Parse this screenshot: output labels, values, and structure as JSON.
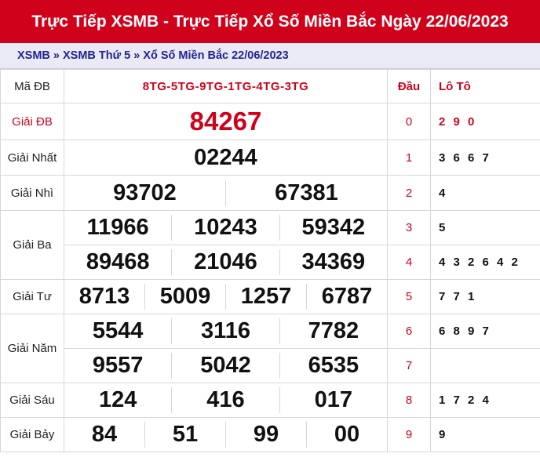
{
  "title": "Trực Tiếp XSMB - Trực Tiếp Xổ Số Miền Bắc Ngày 22/06/2023",
  "breadcrumb": [
    "XSMB",
    "XSMB Thứ 5",
    "Xổ Số Miền Bắc 22/06/2023"
  ],
  "breadcrumb_sep": "»",
  "header": {
    "ma_db_label": "Mã ĐB",
    "ma_db_value": "8TG-5TG-9TG-1TG-4TG-3TG",
    "dau_label": "Đầu",
    "loto_label": "Lô Tô"
  },
  "prizes": {
    "db": {
      "label": "Giải ĐB",
      "numbers": [
        "84267"
      ]
    },
    "nhat": {
      "label": "Giải Nhất",
      "numbers": [
        "02244"
      ]
    },
    "nhi": {
      "label": "Giải Nhì",
      "numbers": [
        "93702",
        "67381"
      ]
    },
    "ba": {
      "label": "Giải Ba",
      "numbers": [
        "11966",
        "10243",
        "59342",
        "89468",
        "21046",
        "34369"
      ]
    },
    "tu": {
      "label": "Giải Tư",
      "numbers": [
        "8713",
        "5009",
        "1257",
        "6787"
      ]
    },
    "nam": {
      "label": "Giải Năm",
      "numbers": [
        "5544",
        "3116",
        "7782",
        "9557",
        "5042",
        "6535"
      ]
    },
    "sau": {
      "label": "Giải Sáu",
      "numbers": [
        "124",
        "416",
        "017"
      ]
    },
    "bay": {
      "label": "Giải Bảy",
      "numbers": [
        "84",
        "51",
        "99",
        "00"
      ]
    }
  },
  "loto": [
    {
      "dau": "0",
      "values": "2 9 0"
    },
    {
      "dau": "1",
      "values": "3 6 6 7"
    },
    {
      "dau": "2",
      "values": "4"
    },
    {
      "dau": "3",
      "values": "5"
    },
    {
      "dau": "4",
      "values": "4 3 2 6 4 2"
    },
    {
      "dau": "5",
      "values": "7 7 1"
    },
    {
      "dau": "6",
      "values": "6 8 9 7"
    },
    {
      "dau": "7",
      "values": ""
    },
    {
      "dau": "8",
      "values": "1 7 2 4"
    },
    {
      "dau": "9",
      "values": "9"
    }
  ],
  "colors": {
    "brand_red": "#d0021b",
    "breadcrumb_blue": "#23238e",
    "breadcrumb_bg": "#e9eaf6"
  }
}
